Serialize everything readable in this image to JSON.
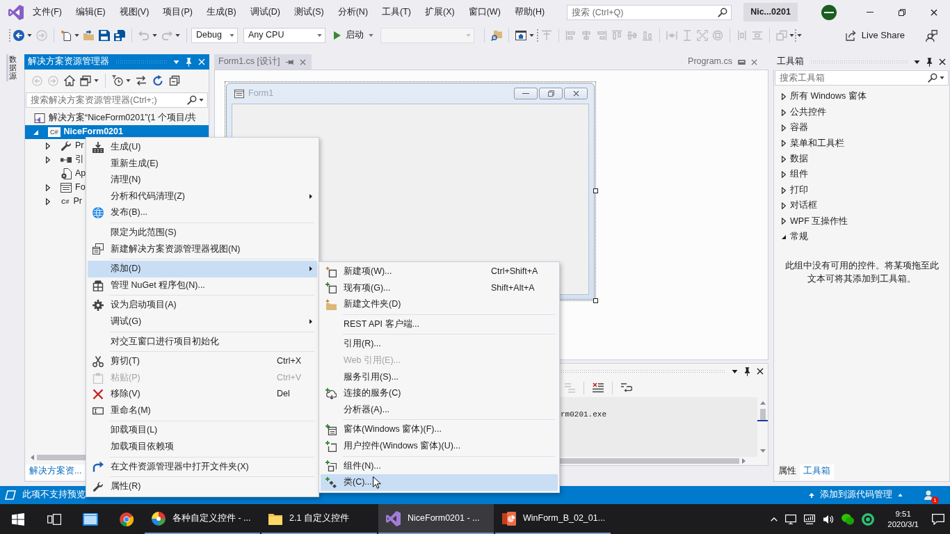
{
  "menu_bar": {
    "items": [
      "文件(F)",
      "编辑(E)",
      "视图(V)",
      "项目(P)",
      "生成(B)",
      "调试(D)",
      "测试(S)",
      "分析(N)",
      "工具(T)",
      "扩展(X)",
      "窗口(W)",
      "帮助(H)"
    ],
    "search": {
      "placeholder": "搜索 (Ctrl+Q)"
    },
    "solution_name": "Nic...0201"
  },
  "toolbar": {
    "configuration": "Debug",
    "platform": "Any CPU",
    "start": "启动",
    "live_share": "Live Share"
  },
  "side_tabs": [
    {
      "label": "数据源"
    }
  ],
  "solution_explorer": {
    "title": "解决方案资源管理器",
    "search": {
      "placeholder": "搜索解决方案资源管理器(Ctrl+;)"
    },
    "tree": [
      {
        "label": "解决方案“NiceForm0201”(1 个项目/共",
        "kind": "solution",
        "selected": false,
        "children": [
          {
            "label": "NiceForm0201",
            "kind": "project",
            "tag": "C#",
            "expanded": true,
            "selected": true,
            "children": [
              {
                "label": "Pr",
                "kind": "properties",
                "expanded": false,
                "selected": false
              },
              {
                "label": "引",
                "kind": "references",
                "expanded": false,
                "selected": false
              },
              {
                "label": "Ap",
                "kind": "config",
                "selected": false
              },
              {
                "label": "Fo",
                "kind": "form",
                "expanded": false,
                "selected": false
              },
              {
                "label": "Pr",
                "kind": "code",
                "tag": "C#",
                "expanded": false,
                "selected": false
              }
            ]
          }
        ]
      }
    ],
    "bottom_tabs": [
      {
        "label": "解决方案资...",
        "selected": true
      }
    ]
  },
  "editor": {
    "tabs": [
      {
        "label": "Form1.cs [设计]",
        "kind": "document",
        "selected": true
      },
      {
        "label": "Program.cs",
        "kind": "preview",
        "selected": false
      }
    ],
    "form": {
      "title": "Form1"
    }
  },
  "output": {
    "text": "rm0201.exe"
  },
  "toolbox": {
    "title": "工具箱",
    "search": {
      "placeholder": "搜索工具箱"
    },
    "groups": [
      {
        "label": "所有 Windows 窗体",
        "expanded": false
      },
      {
        "label": "公共控件",
        "expanded": false
      },
      {
        "label": "容器",
        "expanded": false
      },
      {
        "label": "菜单和工具栏",
        "expanded": false
      },
      {
        "label": "数据",
        "expanded": false
      },
      {
        "label": "组件",
        "expanded": false
      },
      {
        "label": "打印",
        "expanded": false
      },
      {
        "label": "对话框",
        "expanded": false
      },
      {
        "label": "WPF 互操作性",
        "expanded": false
      },
      {
        "label": "常规",
        "expanded": true
      }
    ],
    "empty_message": "此组中没有可用的控件。将某项拖至此文本可将其添加到工具箱。",
    "bottom_tabs": [
      {
        "label": "属性",
        "selected": false
      },
      {
        "label": "工具箱",
        "selected": true
      }
    ]
  },
  "context_menu": {
    "groups": [
      [
        {
          "label": "生成(U)",
          "selected": false,
          "disabled": false,
          "submenu": false
        },
        {
          "label": "重新生成(E)",
          "selected": false,
          "disabled": false,
          "submenu": false
        },
        {
          "label": "清理(N)",
          "selected": false,
          "disabled": false,
          "submenu": false
        },
        {
          "label": "分析和代码清理(Z)",
          "selected": false,
          "disabled": false,
          "submenu": true
        },
        {
          "label": "发布(B)...",
          "selected": false,
          "disabled": false,
          "submenu": false
        }
      ],
      [
        {
          "label": "限定为此范围(S)",
          "selected": false,
          "disabled": false,
          "submenu": false
        },
        {
          "label": "新建解决方案资源管理器视图(N)",
          "selected": false,
          "disabled": false,
          "submenu": false
        }
      ],
      [
        {
          "label": "添加(D)",
          "selected": true,
          "disabled": false,
          "submenu": true
        },
        {
          "label": "管理 NuGet 程序包(N)...",
          "selected": false,
          "disabled": false,
          "submenu": false
        }
      ],
      [
        {
          "label": "设为启动项目(A)",
          "selected": false,
          "disabled": false,
          "submenu": false
        },
        {
          "label": "调试(G)",
          "selected": false,
          "disabled": false,
          "submenu": true
        }
      ],
      [
        {
          "label": "对交互窗口进行项目初始化",
          "selected": false,
          "disabled": false,
          "submenu": false
        }
      ],
      [
        {
          "label": "剪切(T)",
          "shortcut": "Ctrl+X",
          "selected": false,
          "disabled": false,
          "submenu": false
        },
        {
          "label": "粘贴(P)",
          "shortcut": "Ctrl+V",
          "selected": false,
          "disabled": true,
          "submenu": false
        },
        {
          "label": "移除(V)",
          "shortcut": "Del",
          "selected": false,
          "disabled": false,
          "submenu": false
        },
        {
          "label": "重命名(M)",
          "selected": false,
          "disabled": false,
          "submenu": false
        }
      ],
      [
        {
          "label": "卸载项目(L)",
          "selected": false,
          "disabled": false,
          "submenu": false
        },
        {
          "label": "加载项目依赖项",
          "selected": false,
          "disabled": false,
          "submenu": false
        }
      ],
      [
        {
          "label": "在文件资源管理器中打开文件夹(X)",
          "selected": false,
          "disabled": false,
          "submenu": false
        }
      ],
      [
        {
          "label": "属性(R)",
          "selected": false,
          "disabled": false,
          "submenu": false
        }
      ]
    ]
  },
  "add_submenu": {
    "groups": [
      [
        {
          "label": "新建项(W)...",
          "shortcut": "Ctrl+Shift+A",
          "selected": false,
          "disabled": false,
          "submenu": false
        },
        {
          "label": "现有项(G)...",
          "shortcut": "Shift+Alt+A",
          "selected": false,
          "disabled": false,
          "submenu": false
        },
        {
          "label": "新建文件夹(D)",
          "selected": false,
          "disabled": false,
          "submenu": false
        }
      ],
      [
        {
          "label": "REST API 客户端...",
          "selected": false,
          "disabled": false,
          "submenu": false
        }
      ],
      [
        {
          "label": "引用(R)...",
          "selected": false,
          "disabled": false,
          "submenu": false
        },
        {
          "label": "Web 引用(E)...",
          "selected": false,
          "disabled": true,
          "submenu": false
        },
        {
          "label": "服务引用(S)...",
          "selected": false,
          "disabled": false,
          "submenu": false
        },
        {
          "label": "连接的服务(C)",
          "selected": false,
          "disabled": false,
          "submenu": false
        },
        {
          "label": "分析器(A)...",
          "selected": false,
          "disabled": false,
          "submenu": false
        }
      ],
      [
        {
          "label": "窗体(Windows 窗体)(F)...",
          "selected": false,
          "disabled": false,
          "submenu": false
        },
        {
          "label": "用户控件(Windows 窗体)(U)...",
          "selected": false,
          "disabled": false,
          "submenu": false
        }
      ],
      [
        {
          "label": "组件(N)...",
          "selected": false,
          "disabled": false,
          "submenu": false
        },
        {
          "label": "类(C)...",
          "selected": true,
          "disabled": false,
          "submenu": false
        }
      ]
    ]
  },
  "status_bar": {
    "message": "此项不支持预览",
    "source_control": "添加到源代码管理",
    "notification_count": "1"
  },
  "taskbar": {
    "apps": [
      {
        "label": "各种自定义控件 - ...",
        "selected": false
      },
      {
        "label": "2.1 自定义控件",
        "selected": false
      },
      {
        "label": "NiceForm0201 - ...",
        "selected": true
      },
      {
        "label": "WinForm_B_02_01...",
        "selected": false
      }
    ],
    "time": "9:51",
    "date": "2020/3/1"
  }
}
